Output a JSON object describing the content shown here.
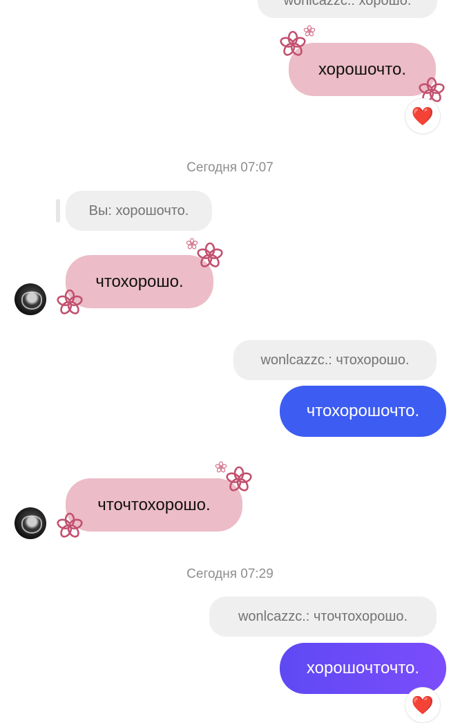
{
  "messages": {
    "top_quote": "wonlcazzc.: хорошо.",
    "msg1": "хорошочто.",
    "reaction1": "❤️",
    "timestamp1": "Сегодня 07:07",
    "quote2": "Вы: хорошочто.",
    "msg2": "чтохорошо.",
    "quote3": "wonlcazzc.: чтохорошо.",
    "msg3": "чтохорошочто.",
    "msg4": "чточтохорошо.",
    "timestamp2": "Сегодня 07:29",
    "quote4": "wonlcazzc.: чточтохорошо.",
    "msg5": "хорошочточто.",
    "reaction2": "❤️"
  },
  "colors": {
    "pink_bubble": "#ecbcc8",
    "blue_bubble": "#3d5cf2",
    "purple_bubble": "#6d4bf7",
    "quote_bg": "#efefef",
    "flower": "#c2506e"
  }
}
